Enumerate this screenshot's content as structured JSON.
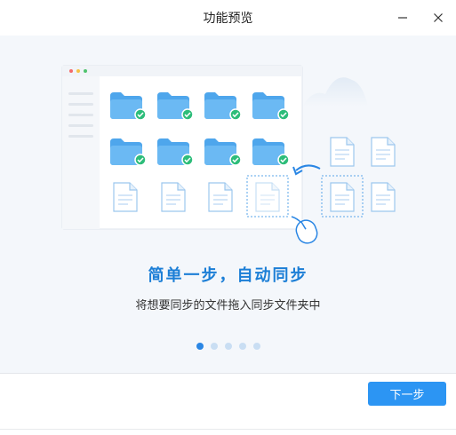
{
  "window": {
    "title": "功能预览",
    "controls": [
      "minimize",
      "close"
    ]
  },
  "slide": {
    "headline": "简单一步，自动同步",
    "description": "将想要同步的文件拖入同步文件夹中",
    "illustration_icons": [
      "browser-window-icon",
      "folder-synced-icon",
      "document-icon",
      "mouse-icon",
      "cloud-icon"
    ]
  },
  "pager": {
    "total": 5,
    "current": 1
  },
  "footer": {
    "next_label": "下一步"
  },
  "colors": {
    "accent": "#2c95f3",
    "headline": "#1b7ed6",
    "folder": "#5fb0f0",
    "check": "#2dbd7a",
    "background": "#f4f7fb"
  }
}
